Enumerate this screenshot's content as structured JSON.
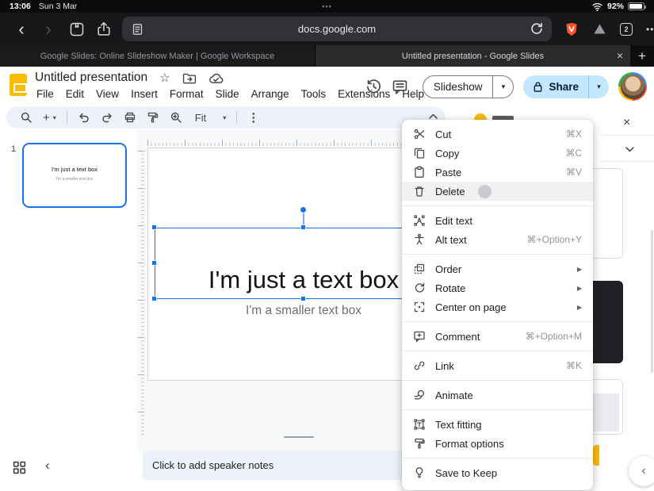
{
  "status_bar": {
    "time": "13:06",
    "date": "Sun 3 Mar",
    "multitask_indicator": "•••",
    "battery_percent": "92%"
  },
  "browser": {
    "back_glyph": "‹",
    "forward_glyph": "›",
    "url": "docs.google.com",
    "tab_count": "2",
    "more_glyph": "•••",
    "tabs": [
      {
        "title": "Google Slides: Online Slideshow Maker | Google Workspace"
      },
      {
        "title": "Untitled presentation - Google Slides",
        "close_glyph": "×"
      }
    ],
    "new_tab_glyph": "+"
  },
  "app_header": {
    "doc_title": "Untitled presentation",
    "star_glyph": "☆",
    "menu_items": [
      "File",
      "Edit",
      "View",
      "Insert",
      "Format",
      "Slide",
      "Arrange",
      "Tools",
      "Extensions",
      "Help"
    ],
    "slideshow_label": "Slideshow",
    "share_label": "Share",
    "caret_glyph": "▾"
  },
  "toolbar": {
    "plus_glyph": "+",
    "caret_glyph": "▾",
    "fit_label": "Fit",
    "more_vert_glyph": "⋮"
  },
  "filmstrip": {
    "slide_number": "1"
  },
  "slide": {
    "textbox_main": "I'm just a text box",
    "textbox_small": "I'm a smaller text box"
  },
  "context_menu": {
    "submenu_arrow": "▶",
    "items": [
      {
        "label": "Cut",
        "shortcut": "⌘X",
        "icon": "scissors-icon"
      },
      {
        "label": "Copy",
        "shortcut": "⌘C",
        "icon": "copy-icon"
      },
      {
        "label": "Paste",
        "shortcut": "⌘V",
        "icon": "clipboard-icon"
      },
      {
        "label": "Delete",
        "shortcut": "",
        "icon": "trash-icon",
        "highlighted": true
      },
      {
        "label": "Edit text",
        "shortcut": "",
        "icon": "edit-text-icon"
      },
      {
        "label": "Alt text",
        "shortcut": "⌘+Option+Y",
        "icon": "accessibility-icon"
      },
      {
        "label": "Order",
        "shortcut": "",
        "icon": "order-icon",
        "submenu": true
      },
      {
        "label": "Rotate",
        "shortcut": "",
        "icon": "rotate-icon",
        "submenu": true
      },
      {
        "label": "Center on page",
        "shortcut": "",
        "icon": "center-on-page-icon",
        "submenu": true
      },
      {
        "label": "Comment",
        "shortcut": "⌘+Option+M",
        "icon": "comment-icon"
      },
      {
        "label": "Link",
        "shortcut": "⌘K",
        "icon": "link-icon"
      },
      {
        "label": "Animate",
        "shortcut": "",
        "icon": "animate-icon"
      },
      {
        "label": "Text fitting",
        "shortcut": "",
        "icon": "text-fitting-icon"
      },
      {
        "label": "Format options",
        "shortcut": "",
        "icon": "paint-roller-icon"
      },
      {
        "label": "Save to Keep",
        "shortcut": "",
        "icon": "lightbulb-icon"
      }
    ]
  },
  "notes": {
    "placeholder": "Click to add speaker notes"
  },
  "panel": {
    "close_glyph": "×"
  },
  "bottom": {
    "filmstrip_collapse_glyph": "‹",
    "panel_collapse_glyph": "‹"
  },
  "colors": {
    "selection_blue": "#1a73e8",
    "share_button_bg": "#c2e7ff",
    "slides_yellow": "#fbbc04",
    "brave_orange": "#fb542b"
  }
}
